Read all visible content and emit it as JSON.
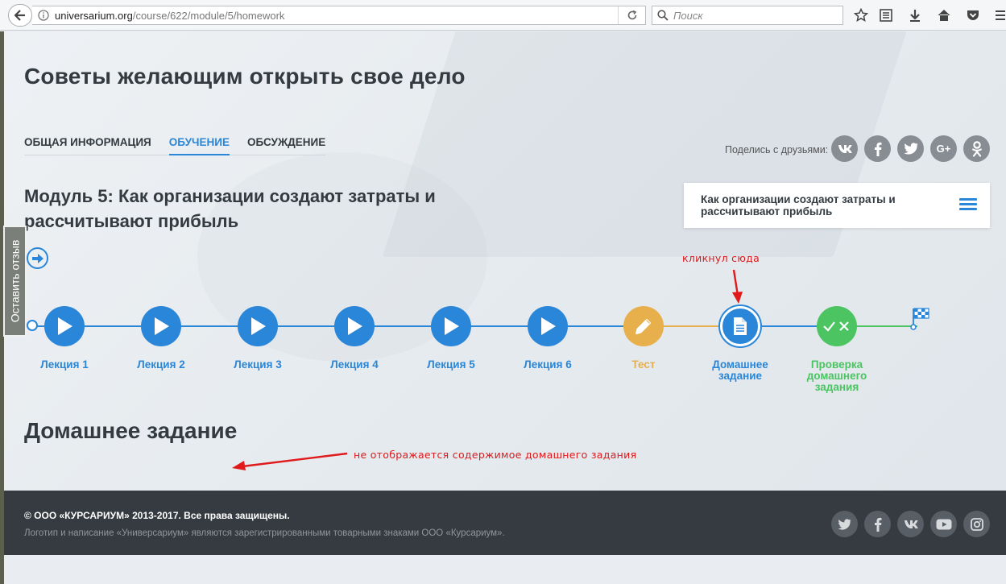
{
  "browser": {
    "url_host": "universarium.org",
    "url_path": "/course/622/module/5/homework",
    "search_placeholder": "Поиск"
  },
  "course": {
    "title": "Советы желающим открыть свое дело",
    "tabs": [
      {
        "label": "ОБЩАЯ ИНФОРМАЦИЯ",
        "active": false
      },
      {
        "label": "ОБУЧЕНИЕ",
        "active": true
      },
      {
        "label": "ОБСУЖДЕНИЕ",
        "active": false
      }
    ]
  },
  "share": {
    "label": "Поделись с друзьями:",
    "networks": [
      {
        "icon": "vk-icon",
        "glyph": "vk"
      },
      {
        "icon": "facebook-icon",
        "glyph": "f"
      },
      {
        "icon": "twitter-icon",
        "glyph": "t"
      },
      {
        "icon": "google-plus-icon",
        "glyph": "G+"
      },
      {
        "icon": "odnoklassniki-icon",
        "glyph": "ok"
      }
    ]
  },
  "module": {
    "title": "Модуль 5: Как организации создают затраты и рассчитывают прибыль",
    "card_title": "Как организации создают затраты и рассчитывают прибыль"
  },
  "feedback": {
    "label": "Оставить отзыв"
  },
  "timeline": {
    "steps": [
      {
        "label": "Лекция 1",
        "type": "lecture",
        "color": "#2a86d8"
      },
      {
        "label": "Лекция 2",
        "type": "lecture",
        "color": "#2a86d8"
      },
      {
        "label": "Лекция 3",
        "type": "lecture",
        "color": "#2a86d8"
      },
      {
        "label": "Лекция 4",
        "type": "lecture",
        "color": "#2a86d8"
      },
      {
        "label": "Лекция 5",
        "type": "lecture",
        "color": "#2a86d8"
      },
      {
        "label": "Лекция 6",
        "type": "lecture",
        "color": "#2a86d8"
      },
      {
        "label": "Тест",
        "type": "test",
        "color": "#e8b04c"
      },
      {
        "label": "Домашнее задание",
        "type": "homework",
        "color": "#2a86d8"
      },
      {
        "label": "Проверка домашнего задания",
        "type": "review",
        "color": "#4cc462"
      }
    ]
  },
  "annotations": {
    "clicked": "кликнул сюда",
    "not_shown": "не отображается содержимое домашнего задания"
  },
  "homework": {
    "title": "Домашнее задание"
  },
  "footer": {
    "copyright": "© ООО «КУРСАРИУМ» 2013-2017. Все права защищены.",
    "legal": "Логотип и написание «Универсариум» являются зарегистрированными товарными знаками ООО «Курсариум».",
    "networks": [
      "twitter-icon",
      "facebook-icon",
      "vk-icon",
      "youtube-icon",
      "instagram-icon"
    ]
  }
}
